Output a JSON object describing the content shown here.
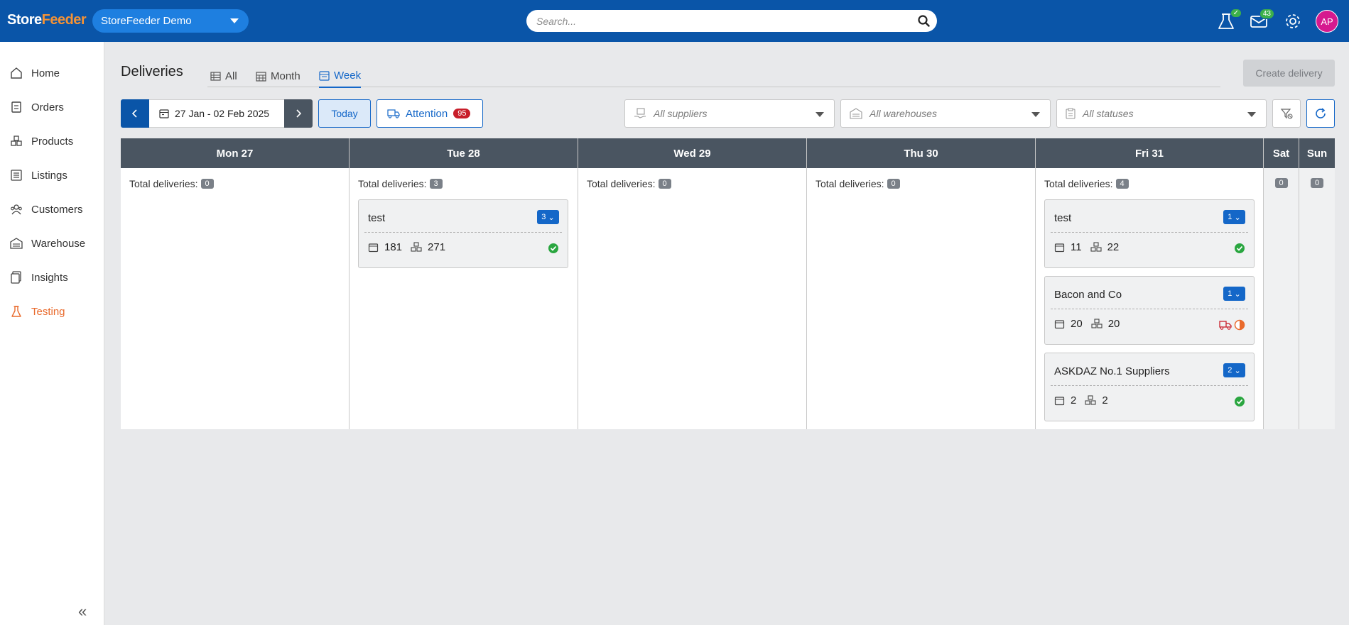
{
  "header": {
    "logo_part1": "Store",
    "logo_part2": "Feeder",
    "store_name": "StoreFeeder Demo",
    "search_placeholder": "Search...",
    "mail_badge": "43",
    "avatar_initials": "AP"
  },
  "sidebar": {
    "items": [
      {
        "label": "Home",
        "icon": "home-icon"
      },
      {
        "label": "Orders",
        "icon": "orders-icon"
      },
      {
        "label": "Products",
        "icon": "products-icon"
      },
      {
        "label": "Listings",
        "icon": "listings-icon"
      },
      {
        "label": "Customers",
        "icon": "customers-icon"
      },
      {
        "label": "Warehouse",
        "icon": "warehouse-icon"
      },
      {
        "label": "Insights",
        "icon": "insights-icon"
      },
      {
        "label": "Testing",
        "icon": "flask-icon",
        "active": true
      }
    ],
    "collapse_label": "«"
  },
  "page": {
    "title": "Deliveries",
    "tabs": [
      {
        "label": "All"
      },
      {
        "label": "Month"
      },
      {
        "label": "Week",
        "active": true
      }
    ],
    "create_button": "Create delivery"
  },
  "toolbar": {
    "date_range": "27 Jan - 02 Feb 2025",
    "today": "Today",
    "attention_label": "Attention",
    "attention_count": "95",
    "suppliers_placeholder": "All suppliers",
    "warehouses_placeholder": "All warehouses",
    "statuses_placeholder": "All statuses"
  },
  "calendar": {
    "total_label": "Total deliveries:",
    "days": [
      {
        "name": "Mon 27",
        "total": "0"
      },
      {
        "name": "Tue 28",
        "total": "3"
      },
      {
        "name": "Wed 29",
        "total": "0"
      },
      {
        "name": "Thu 30",
        "total": "0"
      },
      {
        "name": "Fri 31",
        "total": "4"
      },
      {
        "name": "Sat",
        "total": "0"
      },
      {
        "name": "Sun",
        "total": "0"
      }
    ],
    "cards": {
      "tue": [
        {
          "title": "test",
          "badge": "3",
          "cartons": "181",
          "units": "271",
          "status": "completed"
        }
      ],
      "fri": [
        {
          "title": "test",
          "badge": "1",
          "cartons": "11",
          "units": "22",
          "status": "completed"
        },
        {
          "title": "Bacon and Co",
          "badge": "1",
          "cartons": "20",
          "units": "20",
          "status": "partial"
        },
        {
          "title": "ASKDAZ No.1 Suppliers",
          "badge": "2",
          "cartons": "2",
          "units": "2",
          "status": "completed"
        }
      ]
    }
  },
  "colors": {
    "header": "#0a55a8",
    "accent": "#1467c8",
    "active_nav": "#e96a2c",
    "success": "#2aa640",
    "warning": "#e96a2c",
    "danger": "#c81e2a"
  }
}
